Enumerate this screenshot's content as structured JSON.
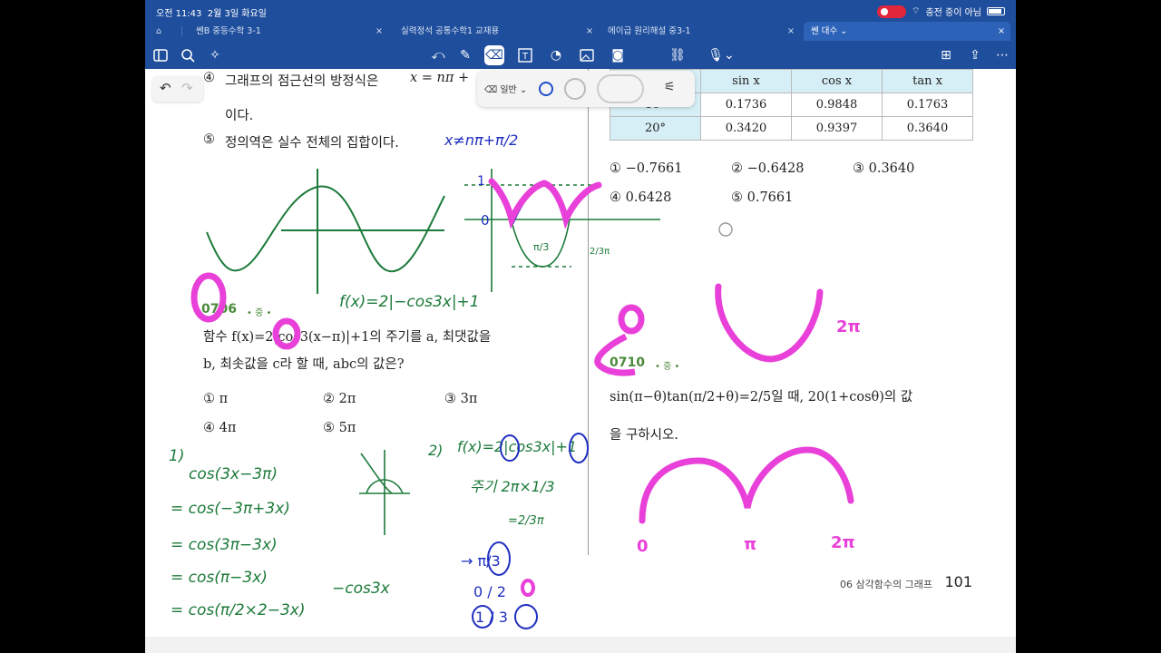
{
  "status": {
    "time": "오전 11:43",
    "date": "2월 3일 화요일",
    "charging": "충전 중이 아님"
  },
  "tabs": [
    {
      "label": "쎈B 중등수학 3-1"
    },
    {
      "label": "실력정석 공통수학1 교재용"
    },
    {
      "label": "에이급 원리해설 중3-1"
    },
    {
      "label": "쎈 대수"
    }
  ],
  "pen_popup": {
    "mode": "일반"
  },
  "toolbar_icons": [
    "sidebar-icon",
    "search-icon",
    "sparkle-icon",
    "undo-icon",
    "pen-icon",
    "eraser-icon",
    "textbox-icon",
    "shape-icon",
    "image-icon",
    "camera-icon",
    "link-icon",
    "mic-icon",
    "add-page-icon",
    "share-icon",
    "more-icon"
  ],
  "left": {
    "item4_line1_prefix": "④",
    "item4_line1": "그래프의 점근선의 방정식은",
    "item4_eq": "x = nπ +",
    "item4_line2": "이다.",
    "item5_mark": "⑤",
    "item5_text": "정의역은 실수 전체의 집합이다.",
    "q0706_num": "0706",
    "q0706_diff": "• 중 •",
    "q0706_line1": "함수 f(x)=2|cos3(x−π)|+1의 주기를 a, 최댓값을",
    "q0706_line2": "b, 최솟값을 c라 할 때, abc의 값은?",
    "choices": [
      "① π",
      "② 2π",
      "③ 3π",
      "④ 4π",
      "⑤ 5π"
    ]
  },
  "right": {
    "table_header": [
      "",
      "sin x",
      "cos x",
      "tan x"
    ],
    "table_rows": [
      [
        "10°",
        "0.1736",
        "0.9848",
        "0.1763"
      ],
      [
        "20°",
        "0.3420",
        "0.9397",
        "0.3640"
      ]
    ],
    "choices": [
      "① −0.7661",
      "② −0.6428",
      "③ 0.3640",
      "④ 0.6428",
      "⑤ 0.7661"
    ],
    "q0710_num": "0710",
    "q0710_diff": "• 중 •",
    "q0710_line1": "sin(π−θ)tan(π/2+θ)=2/5일 때, 20(1+cosθ)의 값",
    "q0710_line2": "을 구하시오."
  },
  "footer": {
    "chapter": "06 삼각함수의 그래프",
    "page": "101"
  },
  "ink_text": {
    "f_def": "f(x)=2|−cos3x|+1",
    "sol1_label": "1)",
    "sol1_lines": [
      "cos(3x−3π)",
      "= cos(−3π+3x)",
      "= cos(3π−3x)",
      "= cos(π−3x)",
      "= cos(π/2×2−3x)"
    ],
    "sol1_side": "−cos3x",
    "sol2_label": "2)",
    "sol2_line": "f(x)=2|cos3x|+1",
    "sol2_period": "주기 2π×1/3",
    "sol2_result": "=2/3π",
    "sol2_arrow": "→ π/3",
    "sol2_max": "0 / 2",
    "sol2_min": "1 / 3",
    "graph_pi3": "π/3",
    "graph_zero": "0",
    "graph_one": "1",
    "graph_23pi": "2/3π",
    "blue_note": "x≠nπ+π/2",
    "pink_2pi_a": "2π",
    "pink_2pi_b": "2π",
    "pink_pi": "π",
    "pink_zero": "0"
  }
}
